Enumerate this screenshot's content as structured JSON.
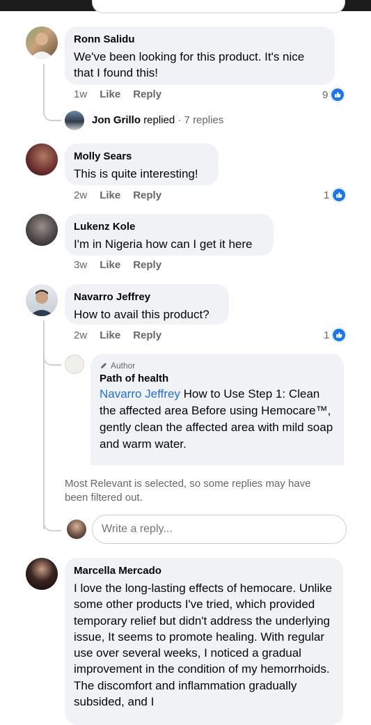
{
  "comments": [
    {
      "author": "Ronn Salidu",
      "text": "We've been looking for this product. It's nice that I found this!",
      "time": "1w",
      "like": "Like",
      "reply": "Reply",
      "reactions": "9"
    },
    {
      "author": "Molly Sears",
      "text": "This is quite interesting!",
      "time": "2w",
      "like": "Like",
      "reply": "Reply",
      "reactions": "1"
    },
    {
      "author": "Lukenz Kole",
      "text": "I'm in Nigeria how can I get it here",
      "time": "3w",
      "like": "Like",
      "reply": "Reply"
    },
    {
      "author": "Navarro Jeffrey",
      "text": "How to avail this product?",
      "time": "2w",
      "like": "Like",
      "reply": "Reply",
      "reactions": "1"
    },
    {
      "author": "Marcella Mercado",
      "text": "I love the long-lasting effects of hemocare. Unlike some other products I've tried, which provided temporary relief but didn't address the underlying issue, It seems to promote healing. With regular use over several weeks, I noticed a gradual improvement in the condition of my hemorrhoids. The discomfort and inflammation gradually subsided, and I"
    }
  ],
  "replies_summary": {
    "name": "Jon Grillo",
    "replied": "replied",
    "count": "· 7 replies"
  },
  "author_reply": {
    "badge": "Author",
    "name": "Path of health",
    "mention": "Navarro Jeffrey",
    "text": "How to Use Step 1: Clean the affected area Before using Hemocare™, gently clean the affected area with mild soap and warm water."
  },
  "filter_notice": "Most Relevant is selected, so some replies may have been filtered out.",
  "reply_input": {
    "placeholder": "Write a reply..."
  },
  "colors": {
    "link": "#216fdb",
    "bubble": "#f0f2f5",
    "like_blue": "#1877f2"
  }
}
